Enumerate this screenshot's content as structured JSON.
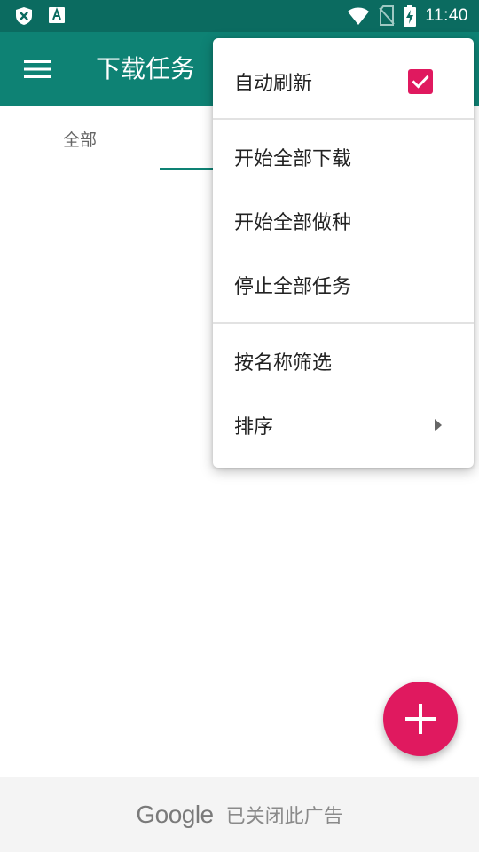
{
  "status_bar": {
    "time": "11:40",
    "icons": [
      "shield-x-icon",
      "text-a-icon",
      "wifi-icon",
      "no-sim-icon",
      "battery-charging-icon"
    ]
  },
  "app_bar": {
    "title": "下载任务",
    "menu_icon": "hamburger-menu-icon"
  },
  "tabs": [
    {
      "label": "全部",
      "selected": false
    },
    {
      "label": "",
      "selected": true
    }
  ],
  "popup_menu": {
    "items": [
      {
        "label": "自动刷新",
        "checked": true
      },
      {
        "label": "开始全部下载"
      },
      {
        "label": "开始全部做种"
      },
      {
        "label": "停止全部任务"
      },
      {
        "label": "按名称筛选"
      },
      {
        "label": "排序",
        "has_submenu": true
      }
    ]
  },
  "fab": {
    "icon": "plus-icon"
  },
  "ad_bar": {
    "logo_text": "Google",
    "message": "已关闭此广告"
  },
  "colors": {
    "status_bar": "#0b6b60",
    "app_bar": "#0e8274",
    "accent": "#e0195f"
  }
}
